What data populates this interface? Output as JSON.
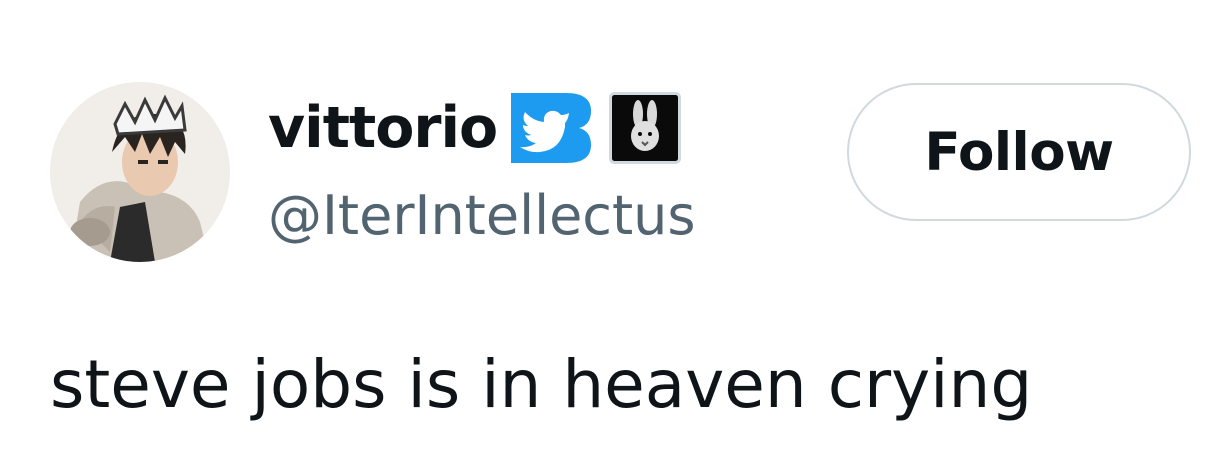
{
  "tweet": {
    "author": {
      "display_name": "vittorio",
      "handle": "@IterIntellectus",
      "avatar_icon": "anime-avatar",
      "badges": [
        {
          "icon": "twitter-bird-verified-badge-icon",
          "color": "#1d9bf0"
        },
        {
          "icon": "rabbit-affiliate-badge-icon",
          "color": "#000000"
        }
      ]
    },
    "follow_button": {
      "label": "Follow"
    },
    "text": "steve jobs is in heaven crying"
  },
  "colors": {
    "primary_text": "#0f1419",
    "secondary_text": "#536471",
    "accent_blue": "#1d9bf0",
    "button_border": "#cfd9de"
  }
}
